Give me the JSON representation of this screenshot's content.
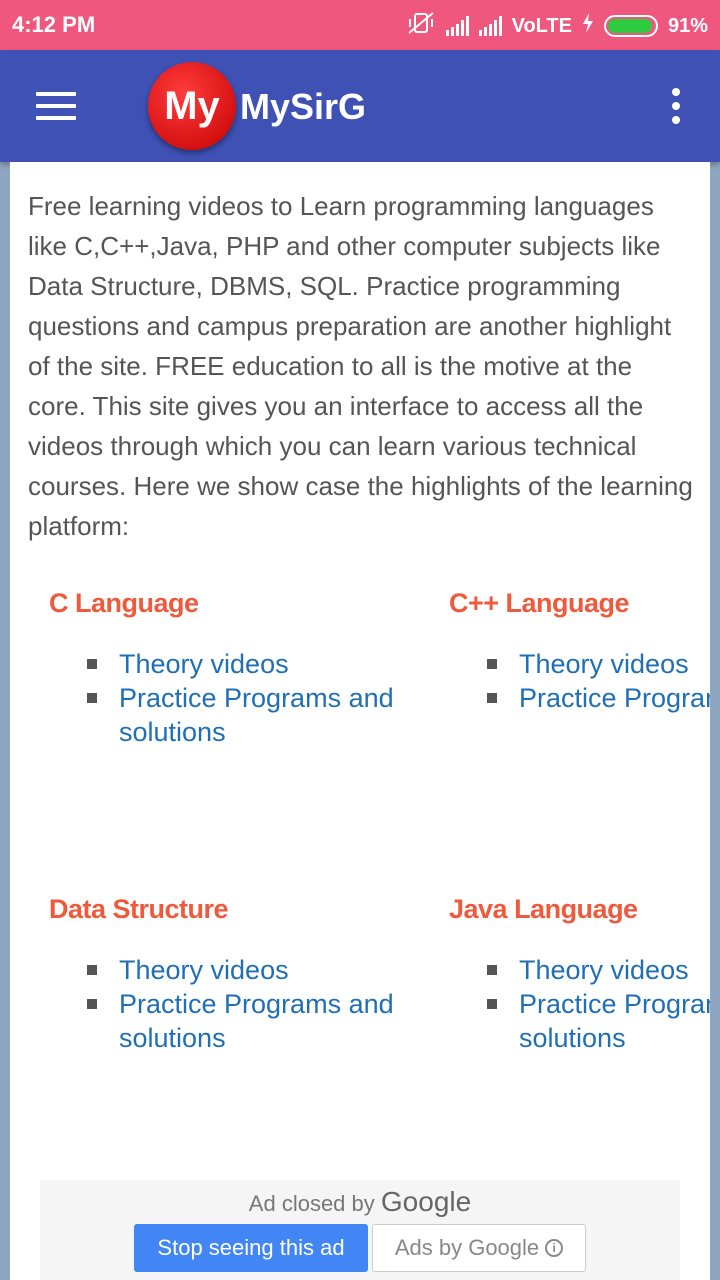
{
  "status_bar": {
    "time": "4:12 PM",
    "network": "VoLTE",
    "battery": "91%",
    "icons": [
      "vibrate-off-icon",
      "signal-icon",
      "signal-icon",
      "charging-icon",
      "battery-icon"
    ]
  },
  "app_bar": {
    "logo_text": "My",
    "title": "MySirG",
    "brand_color": "#3f51b5",
    "logo_color": "#e00000"
  },
  "intro": "Free learning videos to Learn programming languages like C,C++,Java, PHP and other computer subjects like Data Structure, DBMS, SQL. Practice programming questions and campus preparation are another highlight of the site. FREE education to all is the motive at the core. This site gives you an interface to access all the videos through which you can learn various technical courses. Here we show case the highlights of the learning platform:",
  "sections": [
    {
      "title": "C Language",
      "links": [
        "Theory videos",
        "Practice Programs and solutions"
      ]
    },
    {
      "title": "C++ Language",
      "links": [
        "Theory videos",
        "Practice Programs and solutions"
      ]
    },
    {
      "title": "Data Structure",
      "links": [
        "Theory videos",
        "Practice Programs and solutions"
      ]
    },
    {
      "title": "Java Language",
      "links": [
        "Theory videos",
        "Practice Programs and solutions"
      ]
    }
  ],
  "ad": {
    "closed_prefix": "Ad closed by",
    "closed_brand": "Google",
    "stop_button": "Stop seeing this ad",
    "ads_by": "Ads by Google"
  },
  "colors": {
    "status_bar": "#f0577f",
    "heading": "#f05a3c",
    "link": "#1f6fb6",
    "ad_button": "#4285f4"
  }
}
